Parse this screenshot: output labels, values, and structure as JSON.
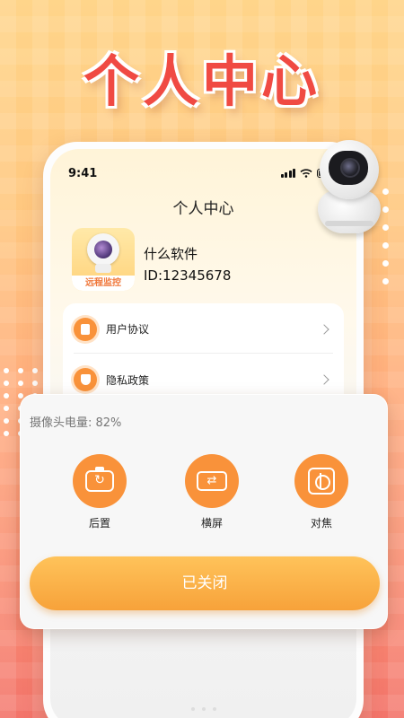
{
  "headline": "个人中心",
  "status_bar": {
    "time": "9:41"
  },
  "screen": {
    "title": "个人中心",
    "app_logo_caption": "远程监控",
    "app_name": "什么软件",
    "app_id": "ID:12345678"
  },
  "menu": {
    "items": [
      {
        "label": "用户协议",
        "icon": "document-icon"
      },
      {
        "label": "隐私政策",
        "icon": "shield-icon"
      }
    ]
  },
  "control_panel": {
    "battery_text": "摄像头电量: 82%",
    "controls": [
      {
        "label": "后置",
        "icon": "camera-switch-icon"
      },
      {
        "label": "横屏",
        "icon": "rotate-screen-icon"
      },
      {
        "label": "对焦",
        "icon": "focus-icon"
      }
    ],
    "status_button": "已关闭"
  },
  "colors": {
    "accent_orange": "#f9923a",
    "headline_red": "#f04a43",
    "button_gradient_top": "#ffc35a",
    "button_gradient_bottom": "#f7a23a"
  }
}
